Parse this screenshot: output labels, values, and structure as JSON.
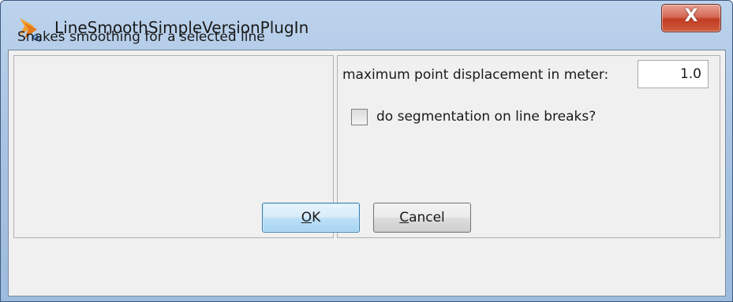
{
  "window": {
    "title": "LineSmoothSimpleVersionPlugIn",
    "close_glyph": "X",
    "icon": "app-icon"
  },
  "left_panel": {
    "description": "Snakes smoothing for a selected line"
  },
  "right_panel": {
    "displacement_label": "maximum point displacement in meter:",
    "displacement_value": "1.0",
    "segmentation_label": "do segmentation on line breaks?",
    "segmentation_checked": false
  },
  "buttons": {
    "ok_mnemonic": "O",
    "ok_rest": "K",
    "cancel_mnemonic": "C",
    "cancel_rest": "ancel"
  },
  "colors": {
    "titlebar": "#a9c4e3",
    "client_bg": "#f0f0f0",
    "close_button": "#c13c22",
    "ok_button": "#bde0f6"
  }
}
